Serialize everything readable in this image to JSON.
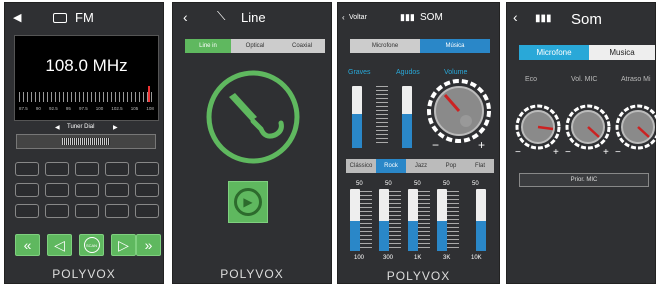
{
  "fm": {
    "title": "FM",
    "frequency": "108.0 MHz",
    "scale": [
      "87.5",
      "90",
      "92.5",
      "95",
      "97.5",
      "100",
      "102.5",
      "105",
      "108"
    ],
    "tuner_label": "Tuner Dial",
    "scan_label": "SCAN",
    "brand": "POLYVOX"
  },
  "line": {
    "title": "Line",
    "tabs": [
      "Line in",
      "Optical",
      "Coaxial"
    ],
    "brand": "POLYVOX"
  },
  "som1": {
    "back_label": "Voltar",
    "title": "SOM",
    "tabs": [
      "Microfone",
      "Música"
    ],
    "labels": [
      "Graves",
      "Agudos",
      "Volume"
    ],
    "presets": [
      "Clássico",
      "Rock",
      "Jazz",
      "Pop",
      "Flat"
    ],
    "eq_values": [
      "50",
      "50",
      "50",
      "50",
      "50"
    ],
    "eq_freqs": [
      "100",
      "300",
      "1K",
      "3K",
      "10K"
    ],
    "brand": "POLYVOX"
  },
  "som2": {
    "title": "Som",
    "tabs": [
      "Microfone",
      "Musica"
    ],
    "labels": [
      "Eco",
      "Vol. MIC",
      "Atraso Mi"
    ],
    "prio_label": "Prior. MIC"
  },
  "colors": {
    "green": "#5fb85f",
    "blue": "#2a87c8",
    "cyan": "#29a8d8"
  }
}
